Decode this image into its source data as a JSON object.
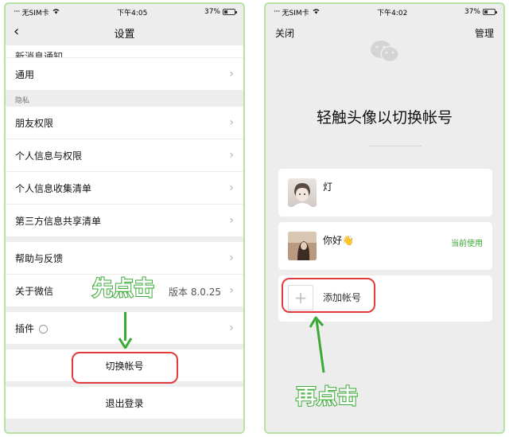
{
  "left": {
    "status": {
      "carrier": "无SIM卡",
      "time": "下午4:05",
      "battery": "37%"
    },
    "nav": {
      "back": "‹",
      "title": "设置"
    },
    "rows": {
      "cut": "新消息通知",
      "general": "通用",
      "section_privacy": "隐私",
      "friends": "朋友权限",
      "personal_info": "个人信息与权限",
      "info_list": "个人信息收集清单",
      "third_party": "第三方信息共享清单",
      "help": "帮助与反馈",
      "about": "关于微信",
      "about_version": "版本 8.0.25",
      "plugins": "插件",
      "switch": "切换帐号",
      "logout": "退出登录"
    },
    "annotation": "先点击"
  },
  "right": {
    "status": {
      "carrier": "无SIM卡",
      "time": "下午4:02",
      "battery": "37%"
    },
    "nav": {
      "close": "关闭",
      "manage": "管理"
    },
    "title": "轻触头像以切换帐号",
    "accounts": [
      {
        "name": "灯",
        "status": ""
      },
      {
        "name": "你好👋",
        "status": "当前使用"
      }
    ],
    "add": {
      "plus": "+",
      "label": "添加帐号"
    },
    "annotation": "再点击"
  },
  "colors": {
    "accent_green": "#3aa935",
    "annotation_red": "#e23b3b",
    "frame_green": "#b6e3a4"
  }
}
